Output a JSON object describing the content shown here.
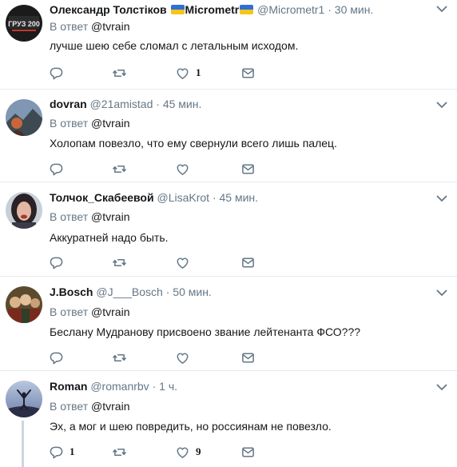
{
  "tweets": [
    {
      "name": "Олександр Толстіков",
      "name_suffix": "Micrometr",
      "handle": "@Micrometr1",
      "time": "30 мин.",
      "reply_prefix": "В ответ",
      "reply_to": "@tvrain",
      "text": "лучше шею себе сломал с летальным исходом.",
      "reply_count": "",
      "like_count": "1",
      "avatar_text": "ГРУЗ 200"
    },
    {
      "name": "dovran",
      "handle": "@21amistad",
      "time": "45 мин.",
      "reply_prefix": "В ответ",
      "reply_to": "@tvrain",
      "text": "Холопам повезло, что ему свернули всего лишь палец.",
      "reply_count": "",
      "like_count": ""
    },
    {
      "name": "Толчок_Скабеевой",
      "handle": "@LisaKrot",
      "time": "45 мин.",
      "reply_prefix": "В ответ",
      "reply_to": "@tvrain",
      "text": "Аккуратней надо быть.",
      "reply_count": "",
      "like_count": ""
    },
    {
      "name": "J.Bosch",
      "handle": "@J___Bosch",
      "time": "50 мин.",
      "reply_prefix": "В ответ",
      "reply_to": "@tvrain",
      "text": "Беслану Мудранову присвоено звание лейтенанта ФСО???",
      "reply_count": "",
      "like_count": ""
    },
    {
      "name": "Roman",
      "handle": "@romanrbv",
      "time": "1 ч.",
      "reply_prefix": "В ответ",
      "reply_to": "@tvrain",
      "text": "Эх, а мог и шею повредить, но россиянам не повезло.",
      "reply_count": "1",
      "like_count": "9"
    }
  ],
  "icons": {
    "reply": "reply-icon",
    "retweet": "retweet-icon",
    "like": "heart-icon",
    "dm": "envelope-icon",
    "more": "chevron-down-icon"
  },
  "colors": {
    "muted": "#657786",
    "text": "#14171a",
    "border": "#e6ecf0",
    "flag_blue": "#2f6fd6",
    "flag_yellow": "#f5c518"
  }
}
